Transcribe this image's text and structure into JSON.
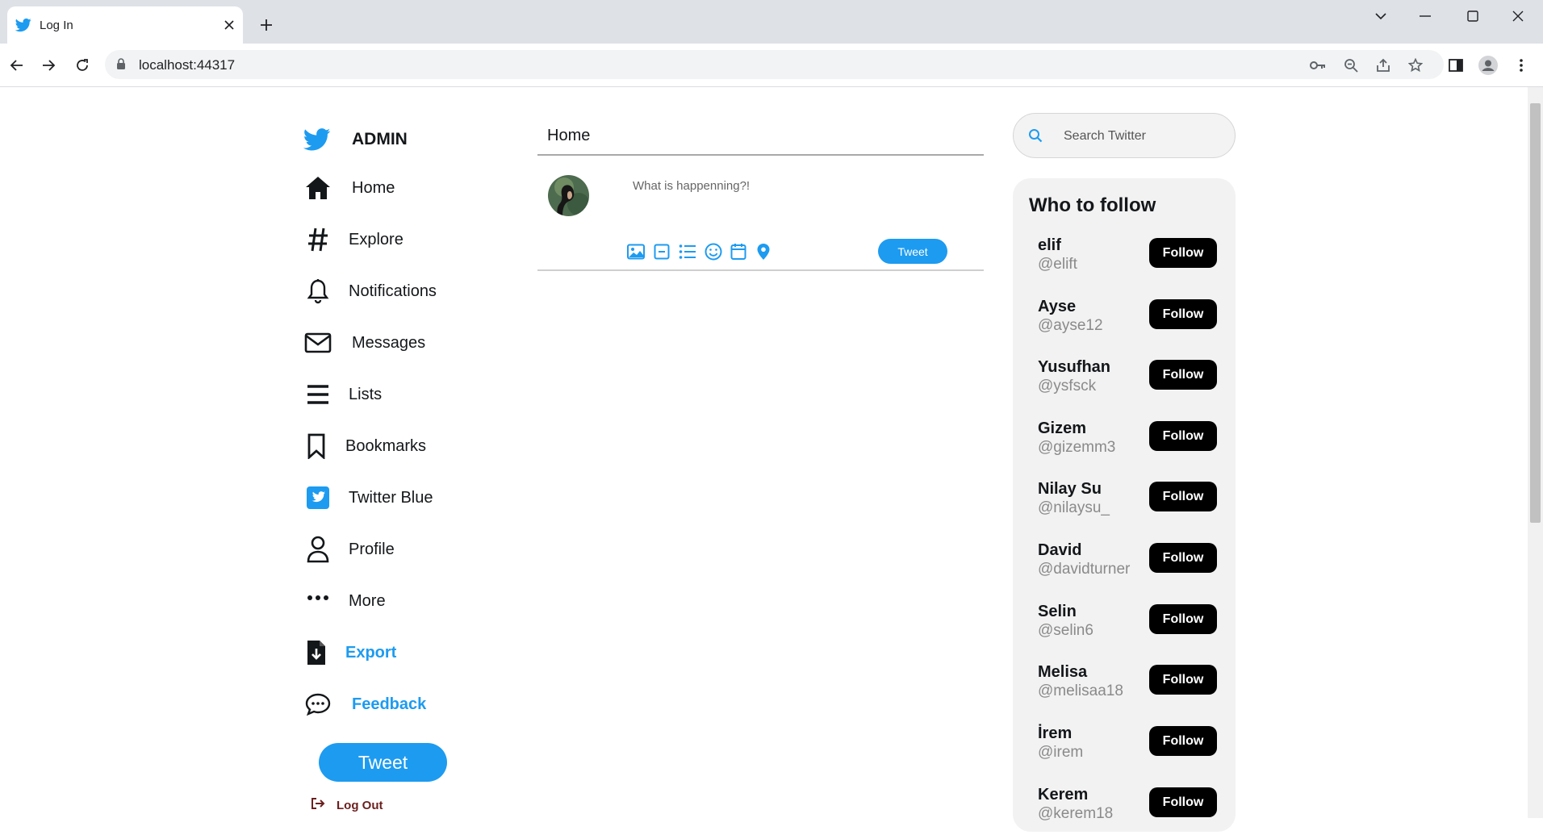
{
  "browser": {
    "tab_title": "Log In",
    "url": "localhost:44317"
  },
  "sidebar": {
    "brand": "ADMIN",
    "items": [
      {
        "label": "Home",
        "icon": "home-icon"
      },
      {
        "label": "Explore",
        "icon": "hashtag-icon"
      },
      {
        "label": "Notifications",
        "icon": "bell-icon"
      },
      {
        "label": "Messages",
        "icon": "envelope-icon"
      },
      {
        "label": "Lists",
        "icon": "list-icon"
      },
      {
        "label": "Bookmarks",
        "icon": "bookmark-icon"
      },
      {
        "label": "Twitter Blue",
        "icon": "twitter-square-icon"
      },
      {
        "label": "Profile",
        "icon": "user-icon"
      },
      {
        "label": "More",
        "icon": "ellipsis-icon"
      },
      {
        "label": "Export",
        "icon": "file-download-icon"
      },
      {
        "label": "Feedback",
        "icon": "comment-dots-icon"
      }
    ],
    "tweet_button": "Tweet",
    "logout": "Log Out"
  },
  "main": {
    "title": "Home",
    "compose_placeholder": "What is happenning?!",
    "tweet_button": "Tweet",
    "compose_icons": [
      "image-icon",
      "gif-icon",
      "poll-icon",
      "emoji-icon",
      "schedule-icon",
      "location-icon"
    ]
  },
  "right": {
    "search_placeholder": "Search Twitter",
    "who_to_follow": {
      "title": "Who to follow",
      "follow_label": "Follow",
      "users": [
        {
          "name": "elif",
          "handle": "@elift"
        },
        {
          "name": "Ayse",
          "handle": "@ayse12"
        },
        {
          "name": "Yusufhan",
          "handle": "@ysfsck"
        },
        {
          "name": "Gizem",
          "handle": "@gizemm3"
        },
        {
          "name": "Nilay Su",
          "handle": "@nilaysu_"
        },
        {
          "name": "David",
          "handle": "@davidturner"
        },
        {
          "name": "Selin",
          "handle": "@selin6"
        },
        {
          "name": "Melisa",
          "handle": "@melisaa18"
        },
        {
          "name": "İrem",
          "handle": "@irem"
        },
        {
          "name": "Kerem",
          "handle": "@kerem18"
        }
      ]
    }
  },
  "colors": {
    "accent": "#1d9bf0",
    "text": "#14171a",
    "muted": "#8a8a8a",
    "panel": "#f2f2f2"
  }
}
